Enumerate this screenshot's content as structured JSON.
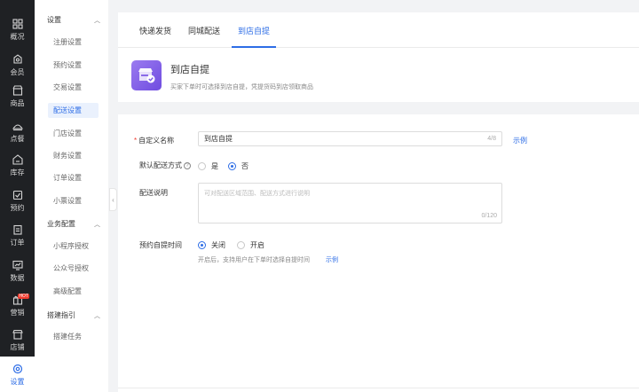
{
  "nav": {
    "items": [
      {
        "label": "概况",
        "icon": "dashboard-icon"
      },
      {
        "label": "会员",
        "icon": "member-icon"
      },
      {
        "label": "商品",
        "icon": "goods-icon"
      },
      {
        "label": "点餐",
        "icon": "order-food-icon"
      },
      {
        "label": "库存",
        "icon": "inventory-icon"
      },
      {
        "label": "预约",
        "icon": "reservation-icon"
      },
      {
        "label": "订单",
        "icon": "order-icon"
      },
      {
        "label": "数据",
        "icon": "data-icon"
      },
      {
        "label": "营销",
        "icon": "marketing-icon",
        "badge": "HOT"
      },
      {
        "label": "店铺",
        "icon": "store-icon"
      },
      {
        "label": "设置",
        "icon": "settings-icon",
        "active": true
      }
    ]
  },
  "submenu": {
    "groups": [
      {
        "title": "设置",
        "items": [
          "注册设置",
          "预约设置",
          "交易设置",
          "配送设置",
          "门店设置",
          "财务设置",
          "订单设置",
          "小票设置"
        ]
      },
      {
        "title": "业务配置",
        "items": [
          "小程序授权",
          "公众号授权",
          "高级配置"
        ]
      },
      {
        "title": "搭建指引",
        "items": [
          "搭建任务"
        ]
      }
    ],
    "active_item": "配送设置"
  },
  "tabs": [
    "快递发货",
    "同城配送",
    "到店自提"
  ],
  "active_tab": "到店自提",
  "hero": {
    "title": "到店自提",
    "desc": "买家下单时可选择到店自提，凭提货码到店领取商品"
  },
  "form": {
    "name_label": "自定义名称",
    "name_value": "到店自提",
    "name_count": "4/8",
    "example_link": "示例",
    "default_label": "默认配送方式",
    "default_yes": "是",
    "default_no": "否",
    "desc_label": "配送说明",
    "desc_placeholder": "可对配送区域范围、配送方式进行说明",
    "desc_count": "0/120",
    "time_label": "预约自提时间",
    "time_off": "关闭",
    "time_on": "开启",
    "time_hint": "开启后，支持用户在下单时选择自提时间",
    "time_example": "示例"
  },
  "colors": {
    "accent": "#2d6de6",
    "nav_bg": "#1f2124",
    "hero_purple": "#7b58e6"
  }
}
